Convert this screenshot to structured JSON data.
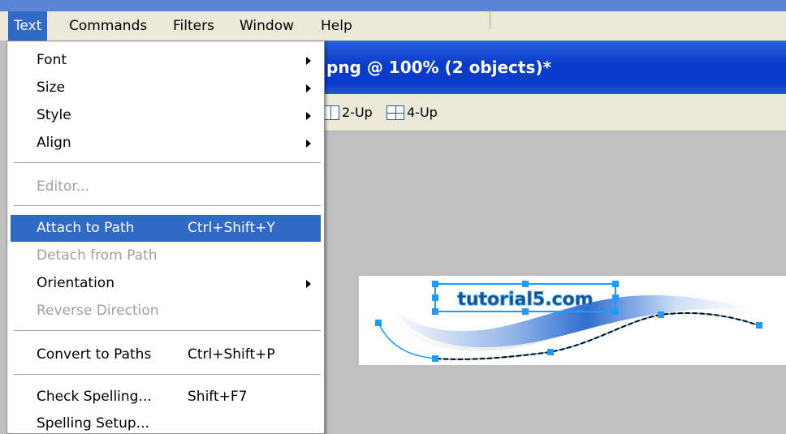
{
  "menubar": {
    "items": [
      {
        "label": "Text",
        "active": true
      },
      {
        "label": "Commands"
      },
      {
        "label": "Filters"
      },
      {
        "label": "Window"
      },
      {
        "label": "Help"
      }
    ]
  },
  "document": {
    "title": "png @ 100% (2 objects)*",
    "views": [
      {
        "label": "2-Up",
        "icon": "two-up-icon"
      },
      {
        "label": "4-Up",
        "icon": "four-up-icon"
      }
    ],
    "artwork_text": "tutorial5.com"
  },
  "text_menu": {
    "items": [
      {
        "label": "Font",
        "submenu": true
      },
      {
        "label": "Size",
        "submenu": true
      },
      {
        "label": "Style",
        "submenu": true
      },
      {
        "label": "Align",
        "submenu": true
      },
      {
        "label": "Editor...",
        "disabled": true
      },
      {
        "label": "Attach to Path",
        "shortcut": "Ctrl+Shift+Y",
        "highlighted": true
      },
      {
        "label": "Detach from Path",
        "disabled": true
      },
      {
        "label": "Orientation",
        "submenu": true
      },
      {
        "label": "Reverse Direction",
        "disabled": true
      },
      {
        "label": "Convert to Paths",
        "shortcut": "Ctrl+Shift+P"
      },
      {
        "label": "Check Spelling...",
        "shortcut": "Shift+F7"
      },
      {
        "label": "Spelling Setup..."
      }
    ]
  },
  "colors": {
    "highlight": "#316ac5",
    "menubar": "#ece9d8",
    "titlebar": "#0a3cc9",
    "selection": "#1e9bff"
  }
}
